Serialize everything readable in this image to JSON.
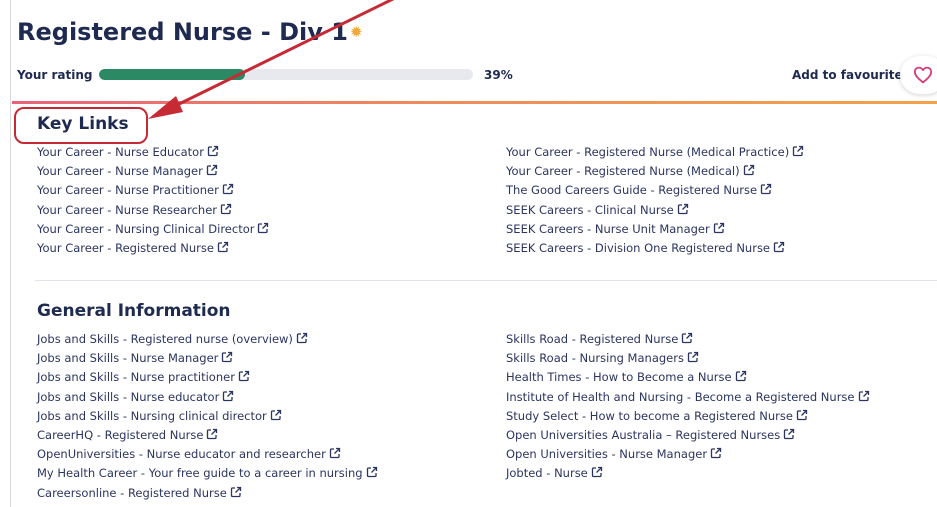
{
  "header": {
    "title": "Registered Nurse - Div 1",
    "star_icon": "sun-badge-icon",
    "rating_label": "Your rating",
    "rating_percent": 39,
    "rating_text": "39%",
    "fav_label": "Add to favourites",
    "fav_icon": "heart-icon"
  },
  "key_links": {
    "title": "Key Links",
    "left": [
      "Your Career - Nurse Educator",
      "Your Career - Nurse Manager",
      "Your Career - Nurse Practitioner",
      "Your Career - Nurse Researcher",
      "Your Career - Nursing Clinical Director",
      "Your Career - Registered Nurse"
    ],
    "right": [
      "Your Career - Registered Nurse (Medical Practice)",
      "Your Career - Registered Nurse (Medical)",
      "The Good Careers Guide - Registered Nurse",
      "SEEK Careers - Clinical Nurse",
      "SEEK Careers - Nurse Unit Manager",
      "SEEK Careers - Division One Registered Nurse"
    ]
  },
  "general_info": {
    "title": "General Information",
    "left": [
      "Jobs and Skills - Registered nurse (overview)",
      "Jobs and Skills - Nurse Manager",
      "Jobs and Skills - Nurse practitioner",
      "Jobs and Skills - Nurse educator",
      "Jobs and Skills - Nursing clinical director",
      "CareerHQ - Registered Nurse",
      "OpenUniversities - Nurse educator and researcher",
      "My Health Career - Your free guide to a career in nursing",
      "Careersonline - Registered Nurse"
    ],
    "right": [
      "Skills Road - Registered Nurse",
      "Skills Road - Nursing Managers",
      "Health Times - How to Become a Nurse",
      "Institute of Health and Nursing - Become a Registered Nurse",
      "Study Select - How to become a Registered Nurse",
      "Open Universities Australia – Registered Nurses",
      "Open Universities - Nurse Manager",
      "Jobted - Nurse"
    ]
  },
  "colors": {
    "accent_green": "#2b8a63",
    "annotation_red": "#c62a35",
    "heart_pink": "#d63a78",
    "title_navy": "#1e2a4f"
  },
  "icons": {
    "external_link": "external-link-icon"
  }
}
